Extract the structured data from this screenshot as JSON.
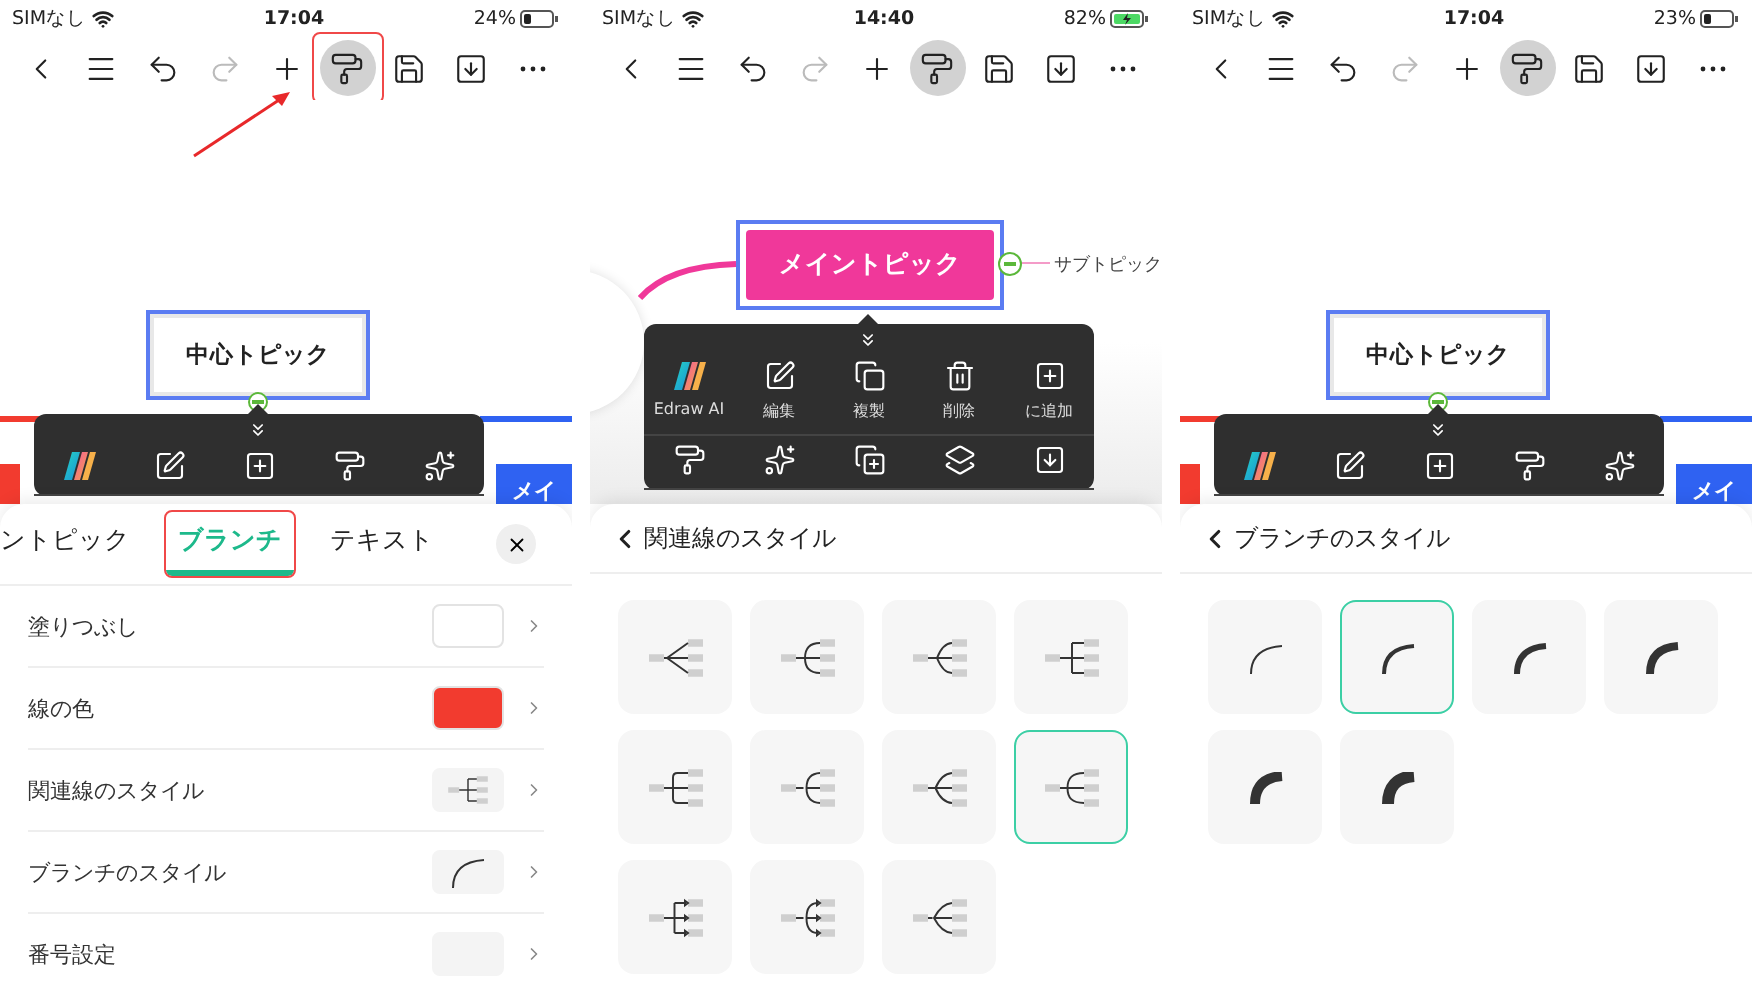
{
  "screens": [
    {
      "status_bar": {
        "carrier": "SIMなし",
        "time": "17:04",
        "battery": "24%",
        "charging": false
      },
      "toolbar": [
        {
          "kind": "back",
          "selected": false,
          "disabled": false,
          "annotated": false
        },
        {
          "kind": "outline",
          "selected": false,
          "disabled": false,
          "annotated": false
        },
        {
          "kind": "undo",
          "selected": false,
          "disabled": false,
          "annotated": false
        },
        {
          "kind": "redo",
          "selected": false,
          "disabled": true,
          "annotated": false
        },
        {
          "kind": "add",
          "selected": false,
          "disabled": false,
          "annotated": false
        },
        {
          "kind": "style",
          "selected": true,
          "disabled": false,
          "annotated": true
        },
        {
          "kind": "save",
          "selected": false,
          "disabled": false,
          "annotated": false
        },
        {
          "kind": "export",
          "selected": false,
          "disabled": false,
          "annotated": false
        },
        {
          "kind": "more",
          "selected": false,
          "disabled": false,
          "annotated": false
        }
      ],
      "canvas": {
        "kind": "central",
        "topic": "中心トピック",
        "side_topic": "メイ"
      },
      "popup": {
        "rows": [
          {
            "items": [
              {
                "kind": "ai"
              },
              {
                "kind": "edit"
              },
              {
                "kind": "add"
              },
              {
                "kind": "style"
              },
              {
                "kind": "magic"
              }
            ]
          }
        ]
      },
      "sheet": {
        "kind": "properties",
        "tabs": [
          {
            "label": "ントピック",
            "selected": false,
            "annotated": false
          },
          {
            "label": "ブランチ",
            "selected": true,
            "annotated": true
          },
          {
            "label": "テキスト",
            "selected": false,
            "annotated": false
          }
        ],
        "rows": [
          {
            "label": "塗りつぶし",
            "kind": "swatch",
            "color": "#ffffff"
          },
          {
            "label": "線の色",
            "kind": "swatch",
            "color": "#f23b2f"
          },
          {
            "label": "関連線のスタイル",
            "kind": "connector"
          },
          {
            "label": "ブランチのスタイル",
            "kind": "branch"
          },
          {
            "label": "番号設定",
            "kind": "blank"
          }
        ]
      }
    },
    {
      "status_bar": {
        "carrier": "SIMなし",
        "time": "14:40",
        "battery": "82%",
        "charging": true
      },
      "toolbar": [
        {
          "kind": "back",
          "selected": false,
          "disabled": false,
          "annotated": false
        },
        {
          "kind": "outline",
          "selected": false,
          "disabled": false,
          "annotated": false
        },
        {
          "kind": "undo",
          "selected": false,
          "disabled": false,
          "annotated": false
        },
        {
          "kind": "redo",
          "selected": false,
          "disabled": true,
          "annotated": false
        },
        {
          "kind": "add",
          "selected": false,
          "disabled": false,
          "annotated": false
        },
        {
          "kind": "style",
          "selected": true,
          "disabled": false,
          "annotated": false
        },
        {
          "kind": "save",
          "selected": false,
          "disabled": false,
          "annotated": false
        },
        {
          "kind": "export",
          "selected": false,
          "disabled": false,
          "annotated": false
        },
        {
          "kind": "more",
          "selected": false,
          "disabled": false,
          "annotated": false
        }
      ],
      "canvas": {
        "kind": "main",
        "topic": "メイントピック",
        "subtopic": "サブトピック"
      },
      "popup": {
        "rows": [
          {
            "items": [
              {
                "kind": "ai",
                "label": "Edraw AI"
              },
              {
                "kind": "edit",
                "label": "編集"
              },
              {
                "kind": "copy",
                "label": "複製"
              },
              {
                "kind": "delete",
                "label": "削除"
              },
              {
                "kind": "add",
                "label": "に追加"
              }
            ]
          },
          {
            "items": [
              {
                "kind": "style"
              },
              {
                "kind": "magic"
              },
              {
                "kind": "copy-plus"
              },
              {
                "kind": "stack"
              },
              {
                "kind": "download"
              }
            ]
          }
        ]
      },
      "sheet": {
        "kind": "connectors",
        "title": "関連線のスタイル",
        "options": [
          {
            "kind": "straight",
            "selected": false
          },
          {
            "kind": "curved",
            "selected": false
          },
          {
            "kind": "bent",
            "selected": false
          },
          {
            "kind": "elbow",
            "selected": false
          },
          {
            "kind": "rounded",
            "selected": false
          },
          {
            "kind": "arc",
            "selected": false
          },
          {
            "kind": "sharp",
            "selected": false
          },
          {
            "kind": "wide",
            "selected": true
          },
          {
            "kind": "arrows",
            "selected": false
          },
          {
            "kind": "arcarrows",
            "selected": false
          },
          {
            "kind": "pointed",
            "selected": false
          }
        ]
      }
    },
    {
      "status_bar": {
        "carrier": "SIMなし",
        "time": "17:04",
        "battery": "23%",
        "charging": false
      },
      "toolbar": [
        {
          "kind": "back",
          "selected": false,
          "disabled": false,
          "annotated": false
        },
        {
          "kind": "outline",
          "selected": false,
          "disabled": false,
          "annotated": false
        },
        {
          "kind": "undo",
          "selected": false,
          "disabled": false,
          "annotated": false
        },
        {
          "kind": "redo",
          "selected": false,
          "disabled": true,
          "annotated": false
        },
        {
          "kind": "add",
          "selected": false,
          "disabled": false,
          "annotated": false
        },
        {
          "kind": "style",
          "selected": true,
          "disabled": false,
          "annotated": false
        },
        {
          "kind": "save",
          "selected": false,
          "disabled": false,
          "annotated": false
        },
        {
          "kind": "export",
          "selected": false,
          "disabled": false,
          "annotated": false
        },
        {
          "kind": "more",
          "selected": false,
          "disabled": false,
          "annotated": false
        }
      ],
      "canvas": {
        "kind": "central",
        "topic": "中心トピック",
        "side_topic": "メイ"
      },
      "popup": {
        "rows": [
          {
            "items": [
              {
                "kind": "ai"
              },
              {
                "kind": "edit"
              },
              {
                "kind": "add"
              },
              {
                "kind": "style"
              },
              {
                "kind": "magic"
              }
            ]
          }
        ]
      },
      "sheet": {
        "kind": "branches",
        "title": "ブランチのスタイル",
        "options": [
          {
            "kind": "thin",
            "selected": false
          },
          {
            "kind": "light",
            "selected": true
          },
          {
            "kind": "regular",
            "selected": false
          },
          {
            "kind": "medium",
            "selected": false
          },
          {
            "kind": "bold",
            "selected": false
          },
          {
            "kind": "heavy",
            "selected": false
          }
        ]
      }
    }
  ]
}
